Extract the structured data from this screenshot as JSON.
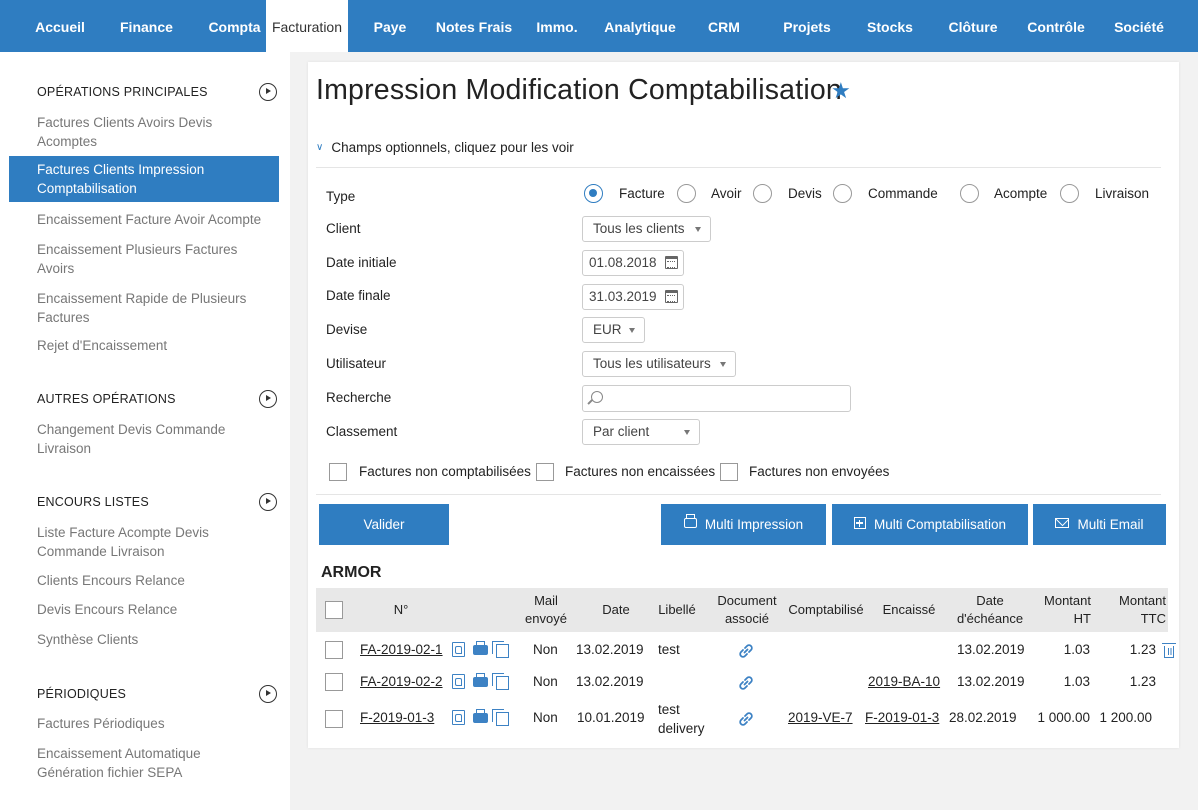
{
  "nav": {
    "tabs": [
      "Accueil",
      "Finance",
      "Compta",
      "Facturation",
      "Paye",
      "Notes Frais",
      "Immo.",
      "Analytique",
      "CRM",
      "Projets",
      "Stocks",
      "Clôture",
      "Contrôle",
      "Société"
    ],
    "active": "Facturation"
  },
  "sidebar": {
    "s1": {
      "header": "OPÉRATIONS PRINCIPALES",
      "items": [
        "Factures Clients Avoirs Devis Acomptes",
        "Factures Clients Impression Comptabilisation",
        "Encaissement Facture Avoir Acompte",
        "Encaissement Plusieurs Factures Avoirs",
        "Encaissement Rapide de Plusieurs Factures",
        "Rejet d'Encaissement"
      ]
    },
    "s2": {
      "header": "AUTRES OPÉRATIONS",
      "items": [
        "Changement Devis Commande Livraison"
      ]
    },
    "s3": {
      "header": "ENCOURS LISTES",
      "items": [
        "Liste Facture Acompte Devis Commande Livraison",
        "Clients Encours Relance",
        "Devis Encours Relance",
        "Synthèse Clients"
      ]
    },
    "s4": {
      "header": "PÉRIODIQUES",
      "items": [
        "Factures Périodiques",
        "Encaissement Automatique Génération fichier SEPA"
      ]
    }
  },
  "page": {
    "title": "Impression Modification Comptabilisation",
    "optional_fields": "Champs optionnels, cliquez pour les voir"
  },
  "form": {
    "labels": {
      "type": "Type",
      "client": "Client",
      "date_start": "Date initiale",
      "date_end": "Date finale",
      "currency": "Devise",
      "user": "Utilisateur",
      "search": "Recherche",
      "sort": "Classement"
    },
    "type_options": [
      "Facture",
      "Avoir",
      "Devis",
      "Commande",
      "Acompte",
      "Livraison"
    ],
    "type_selected": "Facture",
    "client_value": "Tous les clients",
    "date_start_value": "01.08.2018",
    "date_end_value": "31.03.2019",
    "currency_value": "EUR",
    "user_value": "Tous les utilisateurs",
    "search_value": "",
    "sort_value": "Par client",
    "checkboxes": [
      "Factures non comptabilisées",
      "Factures non encaissées",
      "Factures non envoyées"
    ]
  },
  "buttons": {
    "validate": "Valider",
    "multi_print": "Multi Impression",
    "multi_post": "Multi Comptabilisation",
    "multi_email": "Multi Email"
  },
  "table": {
    "group": "ARMOR",
    "headers": {
      "num": "N°",
      "mail": [
        "Mail",
        "envoyé"
      ],
      "date": "Date",
      "label": "Libellé",
      "doc": [
        "Document",
        "associé"
      ],
      "posted": "Comptabilisé",
      "cashed": "Encaissé",
      "due": [
        "Date",
        "d'échéance"
      ],
      "ht": [
        "Montant",
        "HT"
      ],
      "ttc": [
        "Montant",
        "TTC"
      ]
    },
    "rows": [
      {
        "num": "FA-2019-02-1",
        "mail": "Non",
        "date": "13.02.2019",
        "label": [
          "test"
        ],
        "posted": "",
        "cashed": "",
        "due": "13.02.2019",
        "ht": "1.03",
        "ttc": "1.23"
      },
      {
        "num": "FA-2019-02-2",
        "mail": "Non",
        "date": "13.02.2019",
        "label": [
          ""
        ],
        "posted": "",
        "cashed": "2019-BA-10",
        "due": "13.02.2019",
        "ht": "1.03",
        "ttc": "1.23"
      },
      {
        "num": "F-2019-01-3",
        "mail": "Non",
        "date": "10.01.2019",
        "label": [
          "test",
          "delivery"
        ],
        "posted": "2019-VE-7",
        "cashed": "F-2019-01-3",
        "due": "28.02.2019",
        "ht": "1 000.00",
        "ttc": "1 200.00"
      }
    ]
  },
  "colors": {
    "brand": "#2f7dc1",
    "icon": "#3d82c4"
  }
}
